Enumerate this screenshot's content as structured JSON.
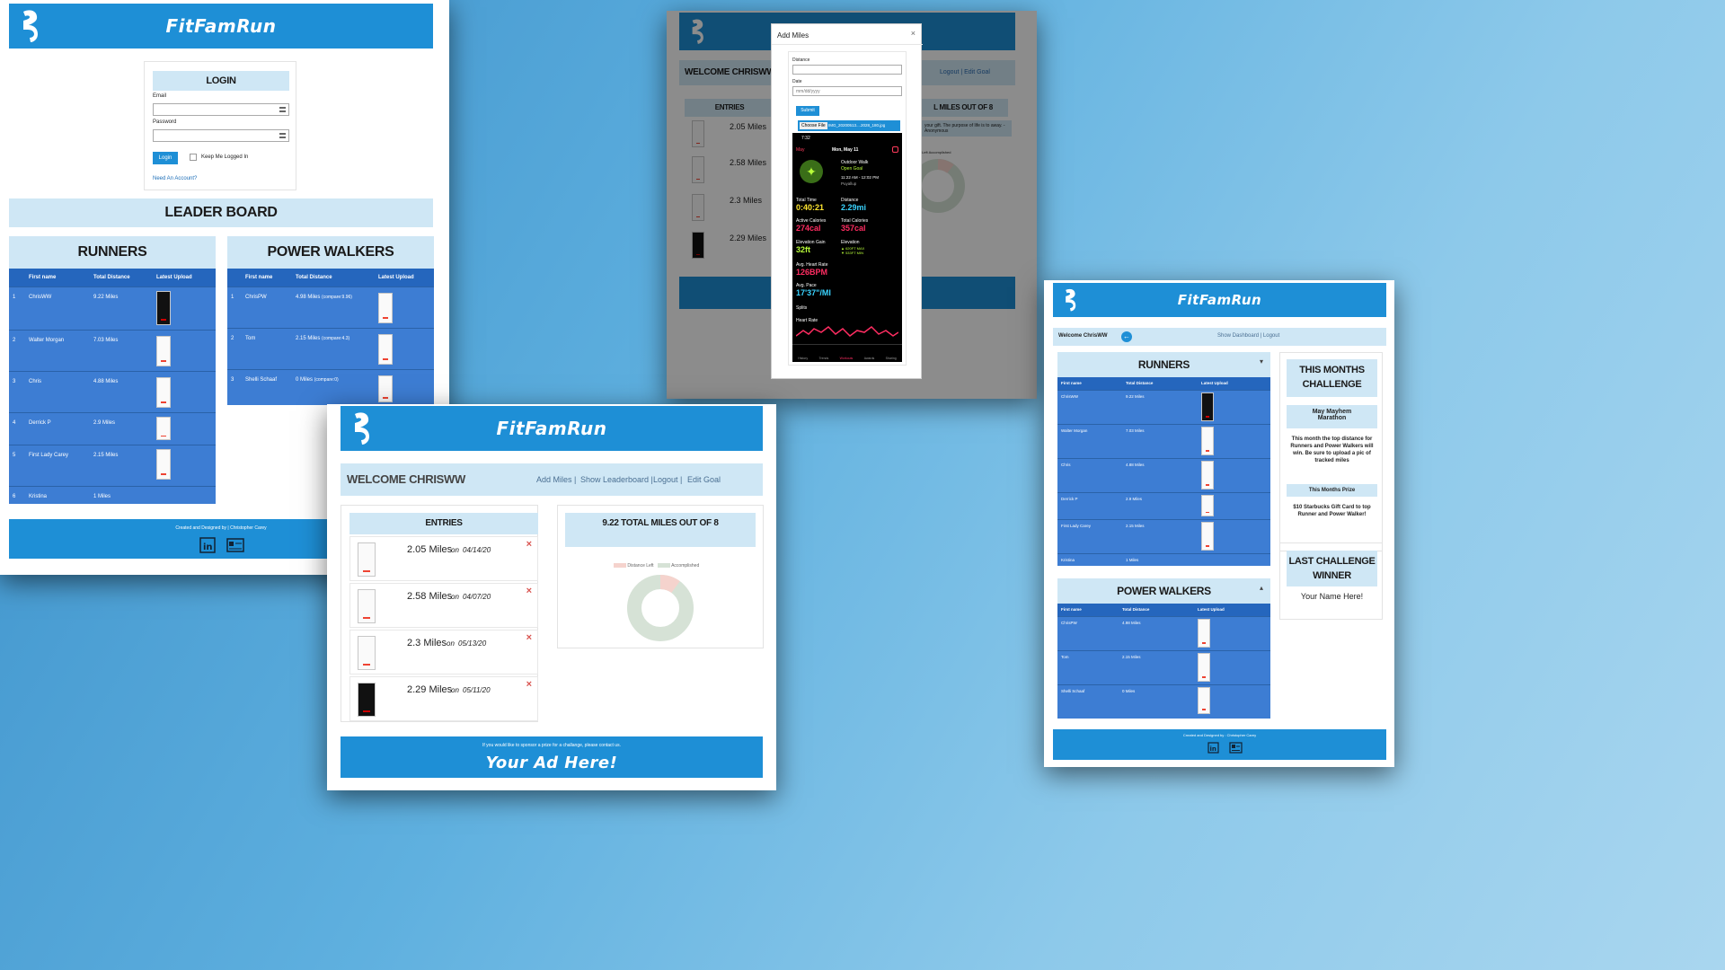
{
  "brand": "FitFamRun",
  "login_window": {
    "login": {
      "title": "LOGIN",
      "email_label": "Email",
      "password_label": "Password",
      "login_button": "Login",
      "keep_logged_in": "Keep Me Logged In",
      "need_account": "Need An Account?"
    },
    "leader_board_title": "LEADER BOARD",
    "runners": {
      "title": "RUNNERS",
      "headers": [
        "First name",
        "Total Distance",
        "Latest Upload"
      ],
      "rows": [
        {
          "rank": "1",
          "name": "ChrisWW",
          "distance": "9.22 Miles"
        },
        {
          "rank": "2",
          "name": "Walter Morgan",
          "distance": "7.03 Miles"
        },
        {
          "rank": "3",
          "name": "Chris",
          "distance": "4.88 Miles"
        },
        {
          "rank": "4",
          "name": "Derrick P",
          "distance": "2.9 Miles"
        },
        {
          "rank": "5",
          "name": "First Lady Carey",
          "distance": "2.15 Miles"
        },
        {
          "rank": "6",
          "name": "Kristina",
          "distance": "1 Miles"
        }
      ]
    },
    "walkers": {
      "title": "POWER WALKERS",
      "headers": [
        "First name",
        "Total Distance",
        "Latest Upload"
      ],
      "rows": [
        {
          "rank": "1",
          "name": "ChrisPW",
          "distance": "4.98 Miles",
          "compare": "(compare:9.96)"
        },
        {
          "rank": "2",
          "name": "Tom",
          "distance": "2.15 Miles",
          "compare": "(compare:4.3)"
        },
        {
          "rank": "3",
          "name": "Shelli Schaaf",
          "distance": "0 Miles",
          "compare": "(compare:0)"
        }
      ]
    },
    "footer": "Created and Designed by | Christopher Carey"
  },
  "modal_window": {
    "welcome": "WELCOME CHRISWW",
    "nav_right": "Logout | Edit Goal",
    "entries_title": "ENTRIES",
    "goal_title": "L MILES OUT OF 8",
    "entries": [
      "2.05 Miles",
      "2.58 Miles",
      "2.3 Miles",
      "2.29 Miles"
    ],
    "quote": "your gift. The purpose of life is to away. - Anonymous",
    "legend": "Left  Accomplished",
    "modal": {
      "title": "Add Miles",
      "close": "×",
      "distance_label": "Distance",
      "date_label": "Date",
      "date_placeholder": "mm/dd/yyyy",
      "submit": "Submit",
      "choose_file": "Choose File",
      "file_name": "IMG_20200513....2028_180.jpg",
      "phone": {
        "time": "7:32",
        "back": "May",
        "date": "Mon, May 11",
        "workout": "Outdoor Walk",
        "goal": "Open Goal",
        "range": "11:22 AM - 12:02 PM",
        "place": "Puyallup",
        "total_time_label": "Total Time",
        "total_time": "0:40:21",
        "distance_label": "Distance",
        "distance": "2.29mi",
        "active_cal_label": "Active Calories",
        "active_cal": "274cal",
        "total_cal_label": "Total Calories",
        "total_cal": "357cal",
        "elev_gain_label": "Elevation Gain",
        "elev_gain": "32ft",
        "elevation_label": "Elevation",
        "elevation_max": "▲ 620FT MAX",
        "elevation_min": "▼ 533FT MIN",
        "hr_label": "Avg. Heart Rate",
        "hr": "126BPM",
        "pace_label": "Avg. Pace",
        "pace": "17'37\"/MI",
        "splits": "Splits",
        "heart_rate": "Heart Rate",
        "tabs": [
          "History",
          "Trends",
          "Workouts",
          "Awards",
          "Sharing"
        ]
      }
    }
  },
  "dashboard_window": {
    "welcome": "WELCOME CHRISWW",
    "nav": [
      "Add Miles |",
      "Show Leaderboard |",
      "Logout |",
      "Edit Goal"
    ],
    "entries_title": "ENTRIES",
    "entries": [
      {
        "miles": "2.05 Miles",
        "on": "on",
        "date": "04/14/20"
      },
      {
        "miles": "2.58 Miles",
        "on": "on",
        "date": "04/07/20"
      },
      {
        "miles": "2.3 Miles",
        "on": "on",
        "date": "05/13/20"
      },
      {
        "miles": "2.29 Miles",
        "on": "on",
        "date": "05/11/20"
      }
    ],
    "delete": "×",
    "goal_title": "9.22 TOTAL MILES OUT OF 8",
    "legend": [
      "Distance Left",
      "Accomplished"
    ],
    "donut": {
      "accomplished_fraction": 0.1,
      "left_color": "#f5d3cd",
      "accomplished_color": "#d6e2d6"
    },
    "sponsor": "If you would like to sponsor a prize for a challange, please contact us.",
    "ad": "Your Ad Here!"
  },
  "right_window": {
    "welcome": "Welcome ChrisWW",
    "nav": "Show Dashboard |  Logout",
    "runners": {
      "title": "RUNNERS",
      "headers": [
        "First name",
        "Total Distance",
        "Latest Upload"
      ],
      "rows": [
        {
          "name": "ChrisWW",
          "distance": "9.22 Miles"
        },
        {
          "name": "Walter Morgan",
          "distance": "7.03 Miles"
        },
        {
          "name": "Chris",
          "distance": "4.88 Miles"
        },
        {
          "name": "Derrick P",
          "distance": "2.9 Miles"
        },
        {
          "name": "First Lady Carey",
          "distance": "2.15 Miles"
        },
        {
          "name": "Kristina",
          "distance": "1 Miles"
        }
      ]
    },
    "walkers": {
      "title": "POWER WALKERS",
      "headers": [
        "First name",
        "Total Distance",
        "Latest Upload"
      ],
      "rows": [
        {
          "name": "ChrisPW",
          "distance": "4.98 Miles"
        },
        {
          "name": "Tom",
          "distance": "2.15 Miles"
        },
        {
          "name": "Shelli Schaaf",
          "distance": "0 Miles"
        }
      ]
    },
    "challenge": {
      "title": "THIS MONTHS CHALLENGE",
      "name": "May Mayhem Marathon",
      "desc": "This month the top distance for Runners and Power Walkers will win. Be sure to upload a pic of tracked miles",
      "prize_title": "This Months Prize",
      "prize": "$10 Starbucks Gift Card to top Runner and Power Walker!"
    },
    "winner": {
      "title": "LAST CHALLENGE WINNER",
      "name": "Your Name Here!"
    },
    "footer": "Created and Designed by : Christopher Carey"
  }
}
